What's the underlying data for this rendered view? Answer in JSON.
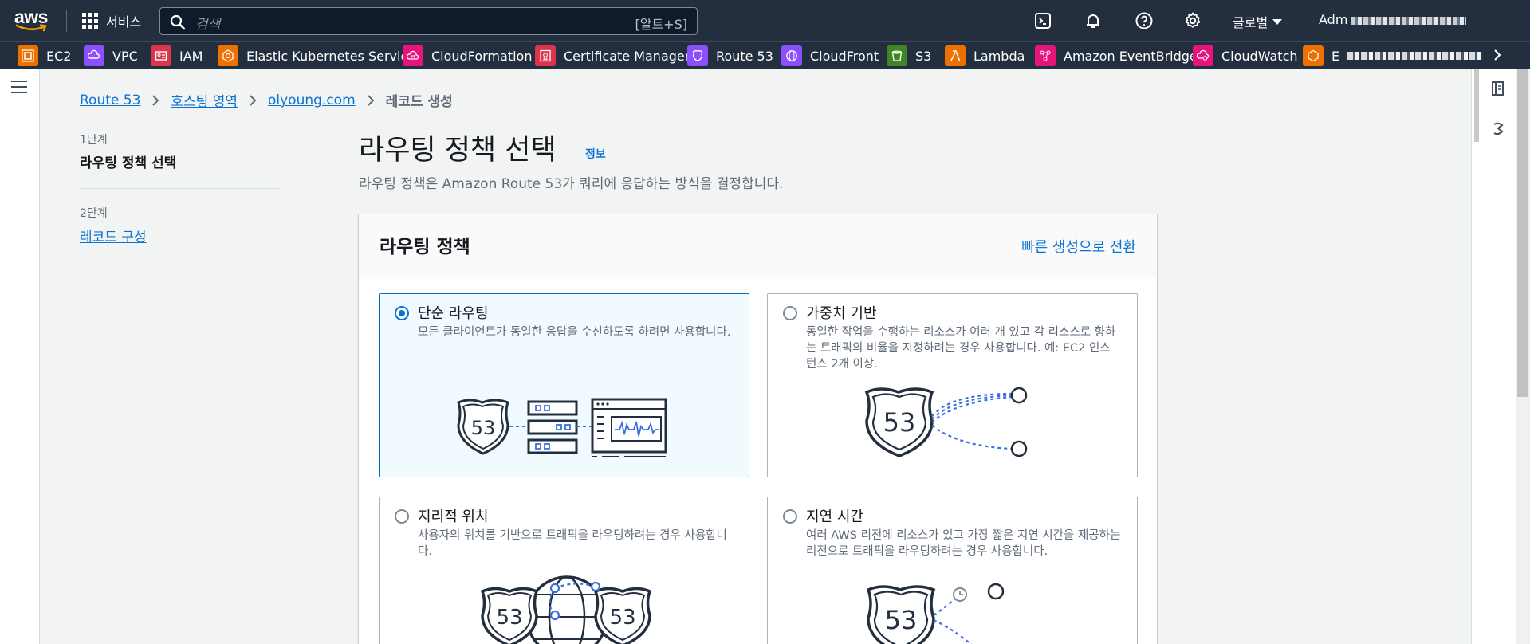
{
  "topnav": {
    "logo": "aws",
    "services_label": "서비스",
    "search_placeholder": "검색",
    "search_shortcut": "[알트+S]",
    "region_label": "글로벌",
    "account_label": "Adm"
  },
  "favorites": [
    {
      "label": "EC2",
      "color": "#ed7100",
      "icon": "ec2-icon"
    },
    {
      "label": "VPC",
      "color": "#8c4fff",
      "icon": "vpc-icon"
    },
    {
      "label": "IAM",
      "color": "#dd344c",
      "icon": "iam-icon"
    },
    {
      "label": "Elastic Kubernetes Service",
      "color": "#ed7100",
      "icon": "eks-icon"
    },
    {
      "label": "CloudFormation",
      "color": "#e7157b",
      "icon": "cloudformation-icon"
    },
    {
      "label": "Certificate Manager",
      "color": "#dd344c",
      "icon": "certificate-manager-icon"
    },
    {
      "label": "Route 53",
      "color": "#8c4fff",
      "icon": "route53-icon"
    },
    {
      "label": "CloudFront",
      "color": "#8c4fff",
      "icon": "cloudfront-icon"
    },
    {
      "label": "S3",
      "color": "#3f8624",
      "icon": "s3-icon"
    },
    {
      "label": "Lambda",
      "color": "#ed7100",
      "icon": "lambda-icon"
    },
    {
      "label": "Amazon EventBridge",
      "color": "#e7157b",
      "icon": "eventbridge-icon"
    },
    {
      "label": "CloudWatch",
      "color": "#e7157b",
      "icon": "cloudwatch-icon"
    },
    {
      "label": "E",
      "color": "#ed7100",
      "icon": "service-icon"
    }
  ],
  "breadcrumb": {
    "items": [
      "Route 53",
      "호스팅 영역",
      "olyoung.com"
    ],
    "current": "레코드 생성"
  },
  "steps": [
    {
      "number": "1단계",
      "title": "라우팅 정책 선택",
      "active": true
    },
    {
      "number": "2단계",
      "title": "레코드 구성",
      "active": false
    }
  ],
  "header": {
    "title": "라우팅 정책 선택",
    "info": "정보",
    "description": "라우팅 정책은 Amazon Route 53가 쿼리에 응답하는 방식을 결정합니다."
  },
  "panel": {
    "title": "라우팅 정책",
    "switch_link": "빠른 생성으로 전환",
    "options": [
      {
        "title": "단순 라우팅",
        "description": "모든 클라이언트가 동일한 응답을 수신하도록 하려면 사용합니다.",
        "selected": true
      },
      {
        "title": "가중치 기반",
        "description": "동일한 작업을 수행하는 리소스가 여러 개 있고 각 리소스로 향하는 트래픽의 비율을 지정하려는 경우 사용합니다. 예: EC2 인스턴스 2개 이상.",
        "selected": false
      },
      {
        "title": "지리적 위치",
        "description": "사용자의 위치를 기반으로 트래픽을 라우팅하려는 경우 사용합니다.",
        "selected": false
      },
      {
        "title": "지연 시간",
        "description": "여러 AWS 리전에 리소스가 있고 가장 짧은 지연 시간을 제공하는 리전으로 트래픽을 라우팅하려는 경우 사용합니다.",
        "selected": false
      }
    ],
    "badge": "53"
  }
}
